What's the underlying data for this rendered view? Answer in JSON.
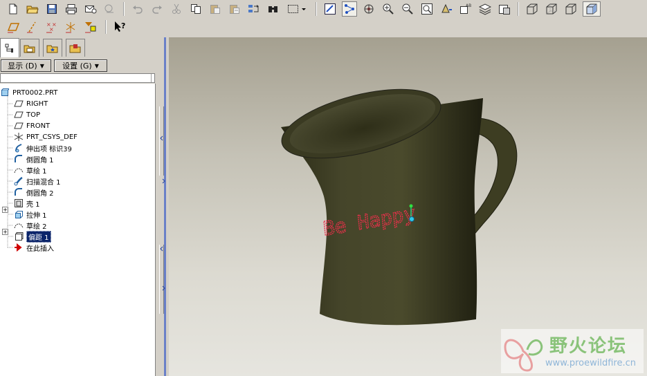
{
  "panel": {
    "display_menu": "显示 (D)",
    "settings_menu": "设置 (G)"
  },
  "tree": {
    "items": [
      {
        "label": "PRT0002.PRT",
        "icon": "part-icon"
      },
      {
        "label": "RIGHT",
        "icon": "datum-plane-icon"
      },
      {
        "label": "TOP",
        "icon": "datum-plane-icon"
      },
      {
        "label": "FRONT",
        "icon": "datum-plane-icon"
      },
      {
        "label": "PRT_CSYS_DEF",
        "icon": "coordinate-system-icon"
      },
      {
        "label": "伸出项 标识39",
        "icon": "protrusion-icon"
      },
      {
        "label": "倒圆角 1",
        "icon": "round-icon"
      },
      {
        "label": "草绘 1",
        "icon": "sketch-icon"
      },
      {
        "label": "扫描混合 1",
        "icon": "swept-blend-icon"
      },
      {
        "label": "倒圆角 2",
        "icon": "round-icon"
      },
      {
        "label": "壳 1",
        "icon": "shell-icon"
      },
      {
        "label": "拉伸 1",
        "icon": "extrude-icon"
      },
      {
        "label": "草绘 2",
        "icon": "sketch-icon"
      },
      {
        "label": "偏距 1",
        "icon": "offset-icon"
      },
      {
        "label": "在此插入",
        "icon": "insert-here-arrow-icon"
      }
    ]
  },
  "model": {
    "decal_text": "Be Happy",
    "body_color": "#3d3d22",
    "decal_color": "#e8304a"
  },
  "watermark": {
    "title": "野火论坛",
    "url": "www.proewildfire.cn"
  }
}
